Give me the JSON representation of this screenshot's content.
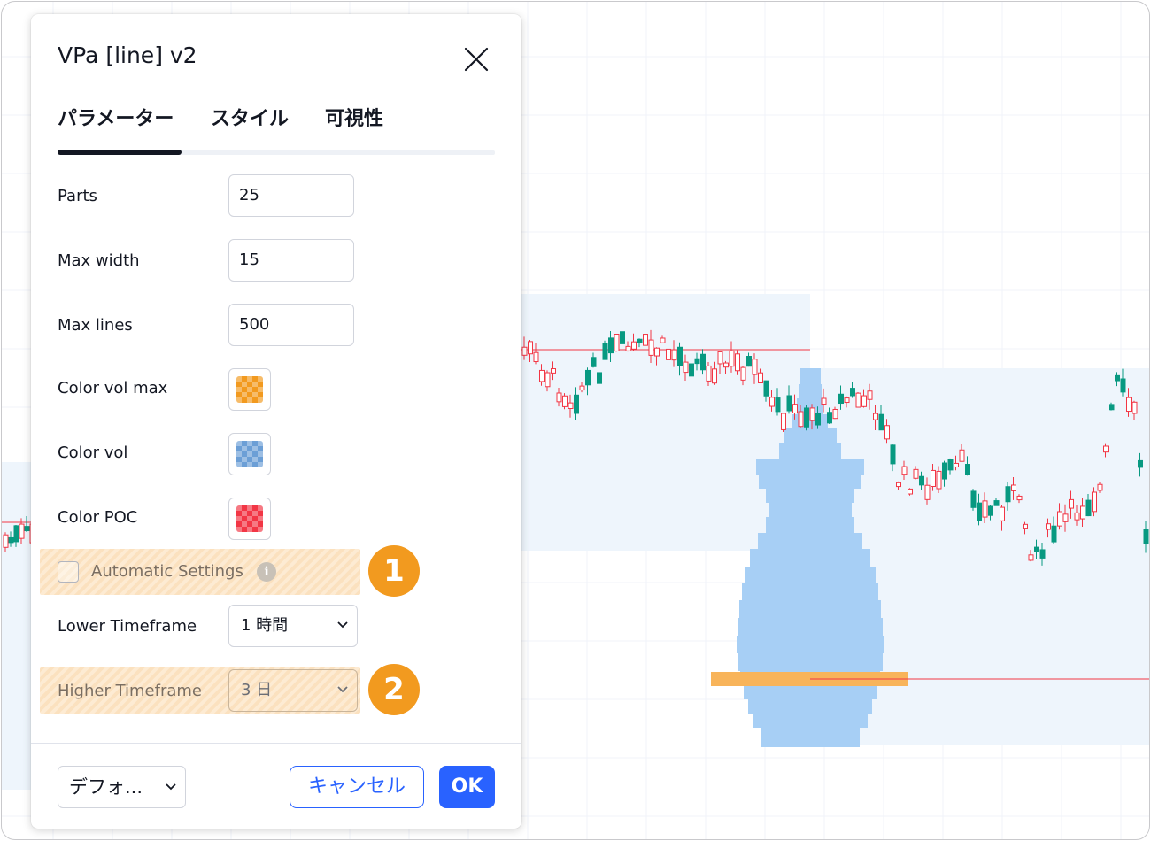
{
  "dialog": {
    "title": "VPa [line] v2",
    "tabs": [
      {
        "label": "パラメーター",
        "active": true
      },
      {
        "label": "スタイル",
        "active": false
      },
      {
        "label": "可視性",
        "active": false
      }
    ],
    "fields": {
      "parts": {
        "label": "Parts",
        "value": "25"
      },
      "max_width": {
        "label": "Max width",
        "value": "15"
      },
      "max_lines": {
        "label": "Max lines",
        "value": "500"
      },
      "color_vol_max": {
        "label": "Color vol max",
        "color": "#f29a1f"
      },
      "color_vol": {
        "label": "Color vol",
        "color": "#6c9fd6"
      },
      "color_poc": {
        "label": "Color POC",
        "color": "#f23645"
      },
      "automatic_settings": {
        "label": "Automatic Settings",
        "checked": false
      },
      "lower_timeframe": {
        "label": "Lower Timeframe",
        "value": "1 時間"
      },
      "higher_timeframe": {
        "label": "Higher Timeframe",
        "value": "3 日"
      }
    },
    "footer": {
      "defaults_label": "デフォ...",
      "cancel_label": "キャンセル",
      "ok_label": "OK"
    }
  },
  "callouts": [
    "1",
    "2"
  ],
  "colors": {
    "accent_blue": "#2962ff",
    "callout_orange": "#f29a1f",
    "candle_up": "#089981",
    "candle_down": "#f23645",
    "volume_profile": "#a7cff5",
    "poc_bar": "#f8b45a"
  },
  "icons": {
    "close": "close-icon",
    "info": "info-icon",
    "chevron": "chevron-down-icon"
  }
}
